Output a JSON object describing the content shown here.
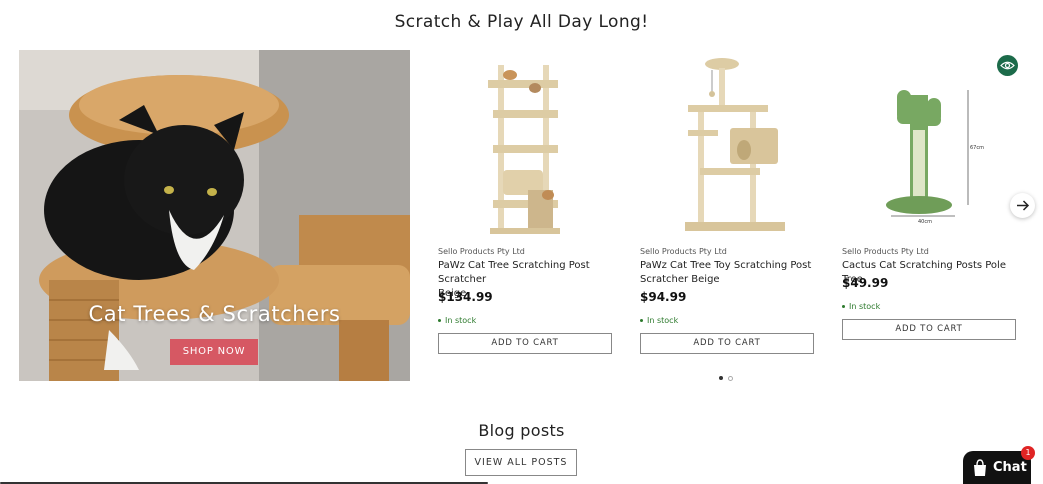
{
  "section": {
    "title": "Scratch & Play All Day Long!"
  },
  "hero": {
    "title": "Cat Trees & Scratchers",
    "button_label": "SHOP NOW",
    "button_color": "#d65863"
  },
  "products": [
    {
      "vendor": "Sello Products Pty Ltd",
      "name_line1": "PaWz Cat Tree Scratching Post Scratcher",
      "name_line2": "Beige",
      "price": "$134.99",
      "stock": "In stock",
      "cart_label": "ADD TO CART"
    },
    {
      "vendor": "Sello Products Pty Ltd",
      "name_line1": "PaWz Cat Tree Toy Scratching Post",
      "name_line2": "Scratcher Beige",
      "price": "$94.99",
      "stock": "In stock",
      "cart_label": "ADD TO CART"
    },
    {
      "vendor": "Sello Products Pty Ltd",
      "name_line1": "Cactus Cat Scratching Posts Pole Tree",
      "name_line2": "",
      "price": "$49.99",
      "stock": "In stock",
      "cart_label": "ADD TO CART",
      "dim_height": "67cm",
      "dim_width": "40cm"
    }
  ],
  "carousel": {
    "pages": 2,
    "active_page": 1
  },
  "blog": {
    "title": "Blog posts",
    "view_all_label": "VIEW ALL POSTS"
  },
  "chat": {
    "label": "Chat",
    "badge": "1"
  },
  "icons": {
    "quick_view": "eye-icon",
    "next": "arrow-right-icon",
    "chat": "shopping-bag-icon"
  },
  "colors": {
    "stock_green": "#2d7a2d",
    "quick_view_green": "#1c6b4a",
    "chat_bg": "#111111",
    "badge_red": "#e02424"
  }
}
